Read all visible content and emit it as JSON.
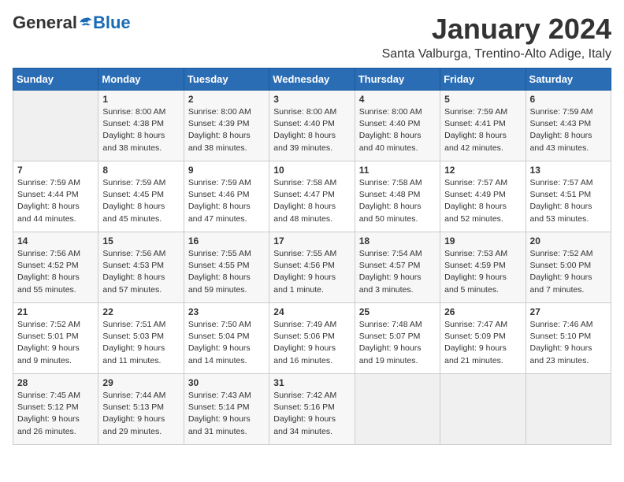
{
  "header": {
    "logo_general": "General",
    "logo_blue": "Blue",
    "title": "January 2024",
    "subtitle": "Santa Valburga, Trentino-Alto Adige, Italy"
  },
  "weekdays": [
    "Sunday",
    "Monday",
    "Tuesday",
    "Wednesday",
    "Thursday",
    "Friday",
    "Saturday"
  ],
  "weeks": [
    [
      {
        "day": "",
        "info": ""
      },
      {
        "day": "1",
        "info": "Sunrise: 8:00 AM\nSunset: 4:38 PM\nDaylight: 8 hours\nand 38 minutes."
      },
      {
        "day": "2",
        "info": "Sunrise: 8:00 AM\nSunset: 4:39 PM\nDaylight: 8 hours\nand 38 minutes."
      },
      {
        "day": "3",
        "info": "Sunrise: 8:00 AM\nSunset: 4:40 PM\nDaylight: 8 hours\nand 39 minutes."
      },
      {
        "day": "4",
        "info": "Sunrise: 8:00 AM\nSunset: 4:40 PM\nDaylight: 8 hours\nand 40 minutes."
      },
      {
        "day": "5",
        "info": "Sunrise: 7:59 AM\nSunset: 4:41 PM\nDaylight: 8 hours\nand 42 minutes."
      },
      {
        "day": "6",
        "info": "Sunrise: 7:59 AM\nSunset: 4:43 PM\nDaylight: 8 hours\nand 43 minutes."
      }
    ],
    [
      {
        "day": "7",
        "info": "Sunrise: 7:59 AM\nSunset: 4:44 PM\nDaylight: 8 hours\nand 44 minutes."
      },
      {
        "day": "8",
        "info": "Sunrise: 7:59 AM\nSunset: 4:45 PM\nDaylight: 8 hours\nand 45 minutes."
      },
      {
        "day": "9",
        "info": "Sunrise: 7:59 AM\nSunset: 4:46 PM\nDaylight: 8 hours\nand 47 minutes."
      },
      {
        "day": "10",
        "info": "Sunrise: 7:58 AM\nSunset: 4:47 PM\nDaylight: 8 hours\nand 48 minutes."
      },
      {
        "day": "11",
        "info": "Sunrise: 7:58 AM\nSunset: 4:48 PM\nDaylight: 8 hours\nand 50 minutes."
      },
      {
        "day": "12",
        "info": "Sunrise: 7:57 AM\nSunset: 4:49 PM\nDaylight: 8 hours\nand 52 minutes."
      },
      {
        "day": "13",
        "info": "Sunrise: 7:57 AM\nSunset: 4:51 PM\nDaylight: 8 hours\nand 53 minutes."
      }
    ],
    [
      {
        "day": "14",
        "info": "Sunrise: 7:56 AM\nSunset: 4:52 PM\nDaylight: 8 hours\nand 55 minutes."
      },
      {
        "day": "15",
        "info": "Sunrise: 7:56 AM\nSunset: 4:53 PM\nDaylight: 8 hours\nand 57 minutes."
      },
      {
        "day": "16",
        "info": "Sunrise: 7:55 AM\nSunset: 4:55 PM\nDaylight: 8 hours\nand 59 minutes."
      },
      {
        "day": "17",
        "info": "Sunrise: 7:55 AM\nSunset: 4:56 PM\nDaylight: 9 hours\nand 1 minute."
      },
      {
        "day": "18",
        "info": "Sunrise: 7:54 AM\nSunset: 4:57 PM\nDaylight: 9 hours\nand 3 minutes."
      },
      {
        "day": "19",
        "info": "Sunrise: 7:53 AM\nSunset: 4:59 PM\nDaylight: 9 hours\nand 5 minutes."
      },
      {
        "day": "20",
        "info": "Sunrise: 7:52 AM\nSunset: 5:00 PM\nDaylight: 9 hours\nand 7 minutes."
      }
    ],
    [
      {
        "day": "21",
        "info": "Sunrise: 7:52 AM\nSunset: 5:01 PM\nDaylight: 9 hours\nand 9 minutes."
      },
      {
        "day": "22",
        "info": "Sunrise: 7:51 AM\nSunset: 5:03 PM\nDaylight: 9 hours\nand 11 minutes."
      },
      {
        "day": "23",
        "info": "Sunrise: 7:50 AM\nSunset: 5:04 PM\nDaylight: 9 hours\nand 14 minutes."
      },
      {
        "day": "24",
        "info": "Sunrise: 7:49 AM\nSunset: 5:06 PM\nDaylight: 9 hours\nand 16 minutes."
      },
      {
        "day": "25",
        "info": "Sunrise: 7:48 AM\nSunset: 5:07 PM\nDaylight: 9 hours\nand 19 minutes."
      },
      {
        "day": "26",
        "info": "Sunrise: 7:47 AM\nSunset: 5:09 PM\nDaylight: 9 hours\nand 21 minutes."
      },
      {
        "day": "27",
        "info": "Sunrise: 7:46 AM\nSunset: 5:10 PM\nDaylight: 9 hours\nand 23 minutes."
      }
    ],
    [
      {
        "day": "28",
        "info": "Sunrise: 7:45 AM\nSunset: 5:12 PM\nDaylight: 9 hours\nand 26 minutes."
      },
      {
        "day": "29",
        "info": "Sunrise: 7:44 AM\nSunset: 5:13 PM\nDaylight: 9 hours\nand 29 minutes."
      },
      {
        "day": "30",
        "info": "Sunrise: 7:43 AM\nSunset: 5:14 PM\nDaylight: 9 hours\nand 31 minutes."
      },
      {
        "day": "31",
        "info": "Sunrise: 7:42 AM\nSunset: 5:16 PM\nDaylight: 9 hours\nand 34 minutes."
      },
      {
        "day": "",
        "info": ""
      },
      {
        "day": "",
        "info": ""
      },
      {
        "day": "",
        "info": ""
      }
    ]
  ]
}
